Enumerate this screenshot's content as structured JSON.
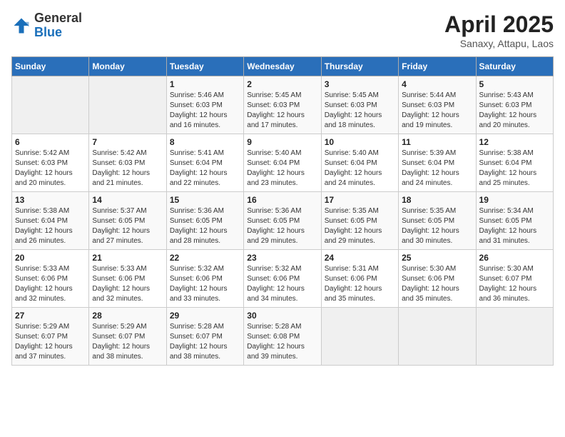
{
  "header": {
    "logo_general": "General",
    "logo_blue": "Blue",
    "month_title": "April 2025",
    "location": "Sanaxy, Attapu, Laos"
  },
  "weekdays": [
    "Sunday",
    "Monday",
    "Tuesday",
    "Wednesday",
    "Thursday",
    "Friday",
    "Saturday"
  ],
  "weeks": [
    [
      {
        "day": "",
        "sunrise": "",
        "sunset": "",
        "daylight": ""
      },
      {
        "day": "",
        "sunrise": "",
        "sunset": "",
        "daylight": ""
      },
      {
        "day": "1",
        "sunrise": "Sunrise: 5:46 AM",
        "sunset": "Sunset: 6:03 PM",
        "daylight": "Daylight: 12 hours and 16 minutes."
      },
      {
        "day": "2",
        "sunrise": "Sunrise: 5:45 AM",
        "sunset": "Sunset: 6:03 PM",
        "daylight": "Daylight: 12 hours and 17 minutes."
      },
      {
        "day": "3",
        "sunrise": "Sunrise: 5:45 AM",
        "sunset": "Sunset: 6:03 PM",
        "daylight": "Daylight: 12 hours and 18 minutes."
      },
      {
        "day": "4",
        "sunrise": "Sunrise: 5:44 AM",
        "sunset": "Sunset: 6:03 PM",
        "daylight": "Daylight: 12 hours and 19 minutes."
      },
      {
        "day": "5",
        "sunrise": "Sunrise: 5:43 AM",
        "sunset": "Sunset: 6:03 PM",
        "daylight": "Daylight: 12 hours and 20 minutes."
      }
    ],
    [
      {
        "day": "6",
        "sunrise": "Sunrise: 5:42 AM",
        "sunset": "Sunset: 6:03 PM",
        "daylight": "Daylight: 12 hours and 20 minutes."
      },
      {
        "day": "7",
        "sunrise": "Sunrise: 5:42 AM",
        "sunset": "Sunset: 6:03 PM",
        "daylight": "Daylight: 12 hours and 21 minutes."
      },
      {
        "day": "8",
        "sunrise": "Sunrise: 5:41 AM",
        "sunset": "Sunset: 6:04 PM",
        "daylight": "Daylight: 12 hours and 22 minutes."
      },
      {
        "day": "9",
        "sunrise": "Sunrise: 5:40 AM",
        "sunset": "Sunset: 6:04 PM",
        "daylight": "Daylight: 12 hours and 23 minutes."
      },
      {
        "day": "10",
        "sunrise": "Sunrise: 5:40 AM",
        "sunset": "Sunset: 6:04 PM",
        "daylight": "Daylight: 12 hours and 24 minutes."
      },
      {
        "day": "11",
        "sunrise": "Sunrise: 5:39 AM",
        "sunset": "Sunset: 6:04 PM",
        "daylight": "Daylight: 12 hours and 24 minutes."
      },
      {
        "day": "12",
        "sunrise": "Sunrise: 5:38 AM",
        "sunset": "Sunset: 6:04 PM",
        "daylight": "Daylight: 12 hours and 25 minutes."
      }
    ],
    [
      {
        "day": "13",
        "sunrise": "Sunrise: 5:38 AM",
        "sunset": "Sunset: 6:04 PM",
        "daylight": "Daylight: 12 hours and 26 minutes."
      },
      {
        "day": "14",
        "sunrise": "Sunrise: 5:37 AM",
        "sunset": "Sunset: 6:05 PM",
        "daylight": "Daylight: 12 hours and 27 minutes."
      },
      {
        "day": "15",
        "sunrise": "Sunrise: 5:36 AM",
        "sunset": "Sunset: 6:05 PM",
        "daylight": "Daylight: 12 hours and 28 minutes."
      },
      {
        "day": "16",
        "sunrise": "Sunrise: 5:36 AM",
        "sunset": "Sunset: 6:05 PM",
        "daylight": "Daylight: 12 hours and 29 minutes."
      },
      {
        "day": "17",
        "sunrise": "Sunrise: 5:35 AM",
        "sunset": "Sunset: 6:05 PM",
        "daylight": "Daylight: 12 hours and 29 minutes."
      },
      {
        "day": "18",
        "sunrise": "Sunrise: 5:35 AM",
        "sunset": "Sunset: 6:05 PM",
        "daylight": "Daylight: 12 hours and 30 minutes."
      },
      {
        "day": "19",
        "sunrise": "Sunrise: 5:34 AM",
        "sunset": "Sunset: 6:05 PM",
        "daylight": "Daylight: 12 hours and 31 minutes."
      }
    ],
    [
      {
        "day": "20",
        "sunrise": "Sunrise: 5:33 AM",
        "sunset": "Sunset: 6:06 PM",
        "daylight": "Daylight: 12 hours and 32 minutes."
      },
      {
        "day": "21",
        "sunrise": "Sunrise: 5:33 AM",
        "sunset": "Sunset: 6:06 PM",
        "daylight": "Daylight: 12 hours and 32 minutes."
      },
      {
        "day": "22",
        "sunrise": "Sunrise: 5:32 AM",
        "sunset": "Sunset: 6:06 PM",
        "daylight": "Daylight: 12 hours and 33 minutes."
      },
      {
        "day": "23",
        "sunrise": "Sunrise: 5:32 AM",
        "sunset": "Sunset: 6:06 PM",
        "daylight": "Daylight: 12 hours and 34 minutes."
      },
      {
        "day": "24",
        "sunrise": "Sunrise: 5:31 AM",
        "sunset": "Sunset: 6:06 PM",
        "daylight": "Daylight: 12 hours and 35 minutes."
      },
      {
        "day": "25",
        "sunrise": "Sunrise: 5:30 AM",
        "sunset": "Sunset: 6:06 PM",
        "daylight": "Daylight: 12 hours and 35 minutes."
      },
      {
        "day": "26",
        "sunrise": "Sunrise: 5:30 AM",
        "sunset": "Sunset: 6:07 PM",
        "daylight": "Daylight: 12 hours and 36 minutes."
      }
    ],
    [
      {
        "day": "27",
        "sunrise": "Sunrise: 5:29 AM",
        "sunset": "Sunset: 6:07 PM",
        "daylight": "Daylight: 12 hours and 37 minutes."
      },
      {
        "day": "28",
        "sunrise": "Sunrise: 5:29 AM",
        "sunset": "Sunset: 6:07 PM",
        "daylight": "Daylight: 12 hours and 38 minutes."
      },
      {
        "day": "29",
        "sunrise": "Sunrise: 5:28 AM",
        "sunset": "Sunset: 6:07 PM",
        "daylight": "Daylight: 12 hours and 38 minutes."
      },
      {
        "day": "30",
        "sunrise": "Sunrise: 5:28 AM",
        "sunset": "Sunset: 6:08 PM",
        "daylight": "Daylight: 12 hours and 39 minutes."
      },
      {
        "day": "",
        "sunrise": "",
        "sunset": "",
        "daylight": ""
      },
      {
        "day": "",
        "sunrise": "",
        "sunset": "",
        "daylight": ""
      },
      {
        "day": "",
        "sunrise": "",
        "sunset": "",
        "daylight": ""
      }
    ]
  ]
}
